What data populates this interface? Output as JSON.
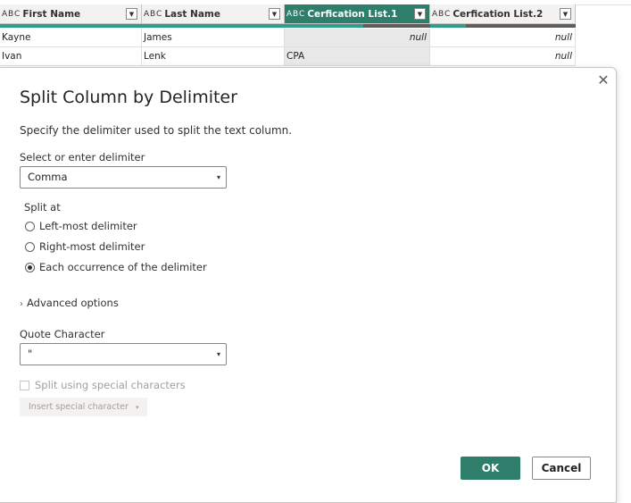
{
  "grid": {
    "columns": [
      {
        "type_icon": "A B C",
        "name": "First Name",
        "selected": false
      },
      {
        "type_icon": "A B C",
        "name": "Last Name",
        "selected": false
      },
      {
        "type_icon": "A B C",
        "name": "Cerfication List.1",
        "selected": true
      },
      {
        "type_icon": "A B C",
        "name": "Cerfication List.2",
        "selected": false
      }
    ],
    "rows": [
      [
        "Kayne",
        "James",
        "null",
        "null"
      ],
      [
        "Ivan",
        "Lenk",
        "CPA",
        "null"
      ]
    ],
    "dropdown_glyph": "▼"
  },
  "dialog": {
    "close_glyph": "✕",
    "title": "Split Column by Delimiter",
    "description": "Specify the delimiter used to split the text column.",
    "delimiter_label": "Select or enter delimiter",
    "delimiter_value": "Comma",
    "select_chevron": "▾",
    "split_at_label": "Split at",
    "split_options": [
      {
        "label": "Left-most delimiter",
        "checked": false
      },
      {
        "label": "Right-most delimiter",
        "checked": false
      },
      {
        "label": "Each occurrence of the delimiter",
        "checked": true
      }
    ],
    "advanced_chevron": "›",
    "advanced_label": "Advanced options",
    "quote_label": "Quote Character",
    "quote_value": "\"",
    "special_chars_label": "Split using special characters",
    "insert_special_label": "Insert special character",
    "ok_label": "OK",
    "cancel_label": "Cancel"
  },
  "colors": {
    "accent": "#2f7d6b",
    "quality_valid": "#2f9e88",
    "quality_empty": "#605e5c"
  }
}
